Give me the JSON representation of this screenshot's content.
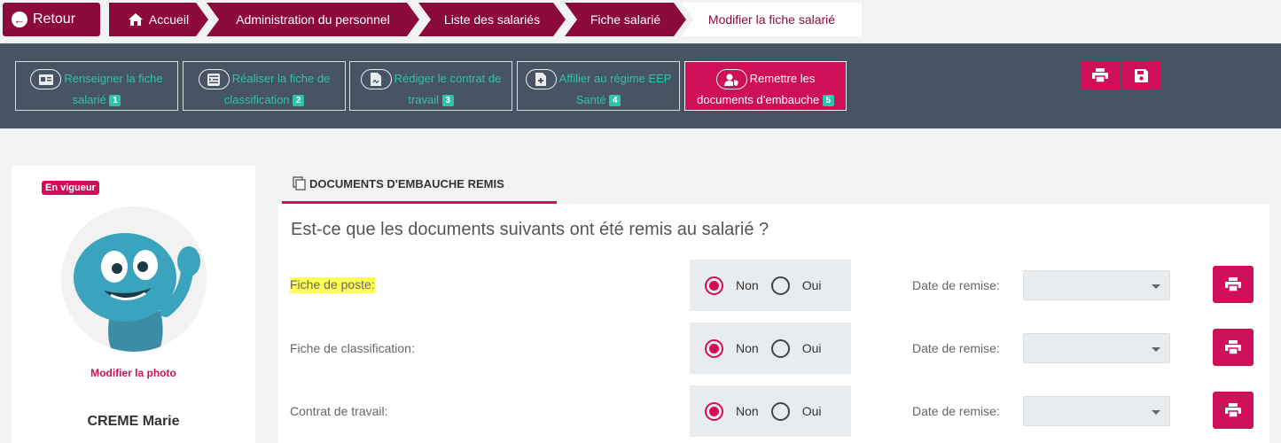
{
  "breadcrumb": {
    "back_label": "Retour",
    "items": [
      {
        "label": "Accueil"
      },
      {
        "label": "Administration du personnel"
      },
      {
        "label": "Liste des salariés"
      },
      {
        "label": "Fiche salarié"
      },
      {
        "label": "Modifier la fiche salarié"
      }
    ]
  },
  "steps": [
    {
      "line1": "Renseigner la fiche",
      "line2": "salarié",
      "num": "1",
      "icon": "id-card-icon"
    },
    {
      "line1": "Réaliser la fiche de",
      "line2": "classification",
      "num": "2",
      "icon": "list-indent-icon"
    },
    {
      "line1": "Rédiger le contrat de",
      "line2": "travail",
      "num": "3",
      "icon": "signed-document-icon"
    },
    {
      "line1": "Affilier au régime EEP",
      "line2": "Santé",
      "num": "4",
      "icon": "medical-file-icon"
    },
    {
      "line1": "Remettre les",
      "line2": "documents d’embauche",
      "num": "5",
      "icon": "user-shield-icon",
      "active": true
    }
  ],
  "toolbar": {
    "print_icon": "print-icon",
    "save_icon": "save-icon"
  },
  "profile": {
    "status": "En vigueur",
    "photo_link": "Modifier la photo",
    "name": "CREME Marie"
  },
  "section": {
    "tab_label": "DOCUMENTS D'EMBAUCHE REMIS",
    "question": "Est-ce que les documents suivants ont été remis au salarié ?",
    "rows": [
      {
        "label": "Fiche de poste:",
        "highlighted": true,
        "no_label": "Non",
        "yes_label": "Oui",
        "selected": "Non",
        "date_label": "Date de remise:",
        "date_value": ""
      },
      {
        "label": "Fiche de classification:",
        "highlighted": false,
        "no_label": "Non",
        "yes_label": "Oui",
        "selected": "Non",
        "date_label": "Date de remise:",
        "date_value": ""
      },
      {
        "label": "Contrat de travail:",
        "highlighted": false,
        "no_label": "Non",
        "yes_label": "Oui",
        "selected": "Non",
        "date_label": "Date de remise:",
        "date_value": ""
      }
    ]
  },
  "colors": {
    "brand_dark": "#8b0a3a",
    "accent": "#cf0f57",
    "teal": "#2ec4a9",
    "toolbar_bg": "#465463",
    "highlight": "#ffff55"
  }
}
